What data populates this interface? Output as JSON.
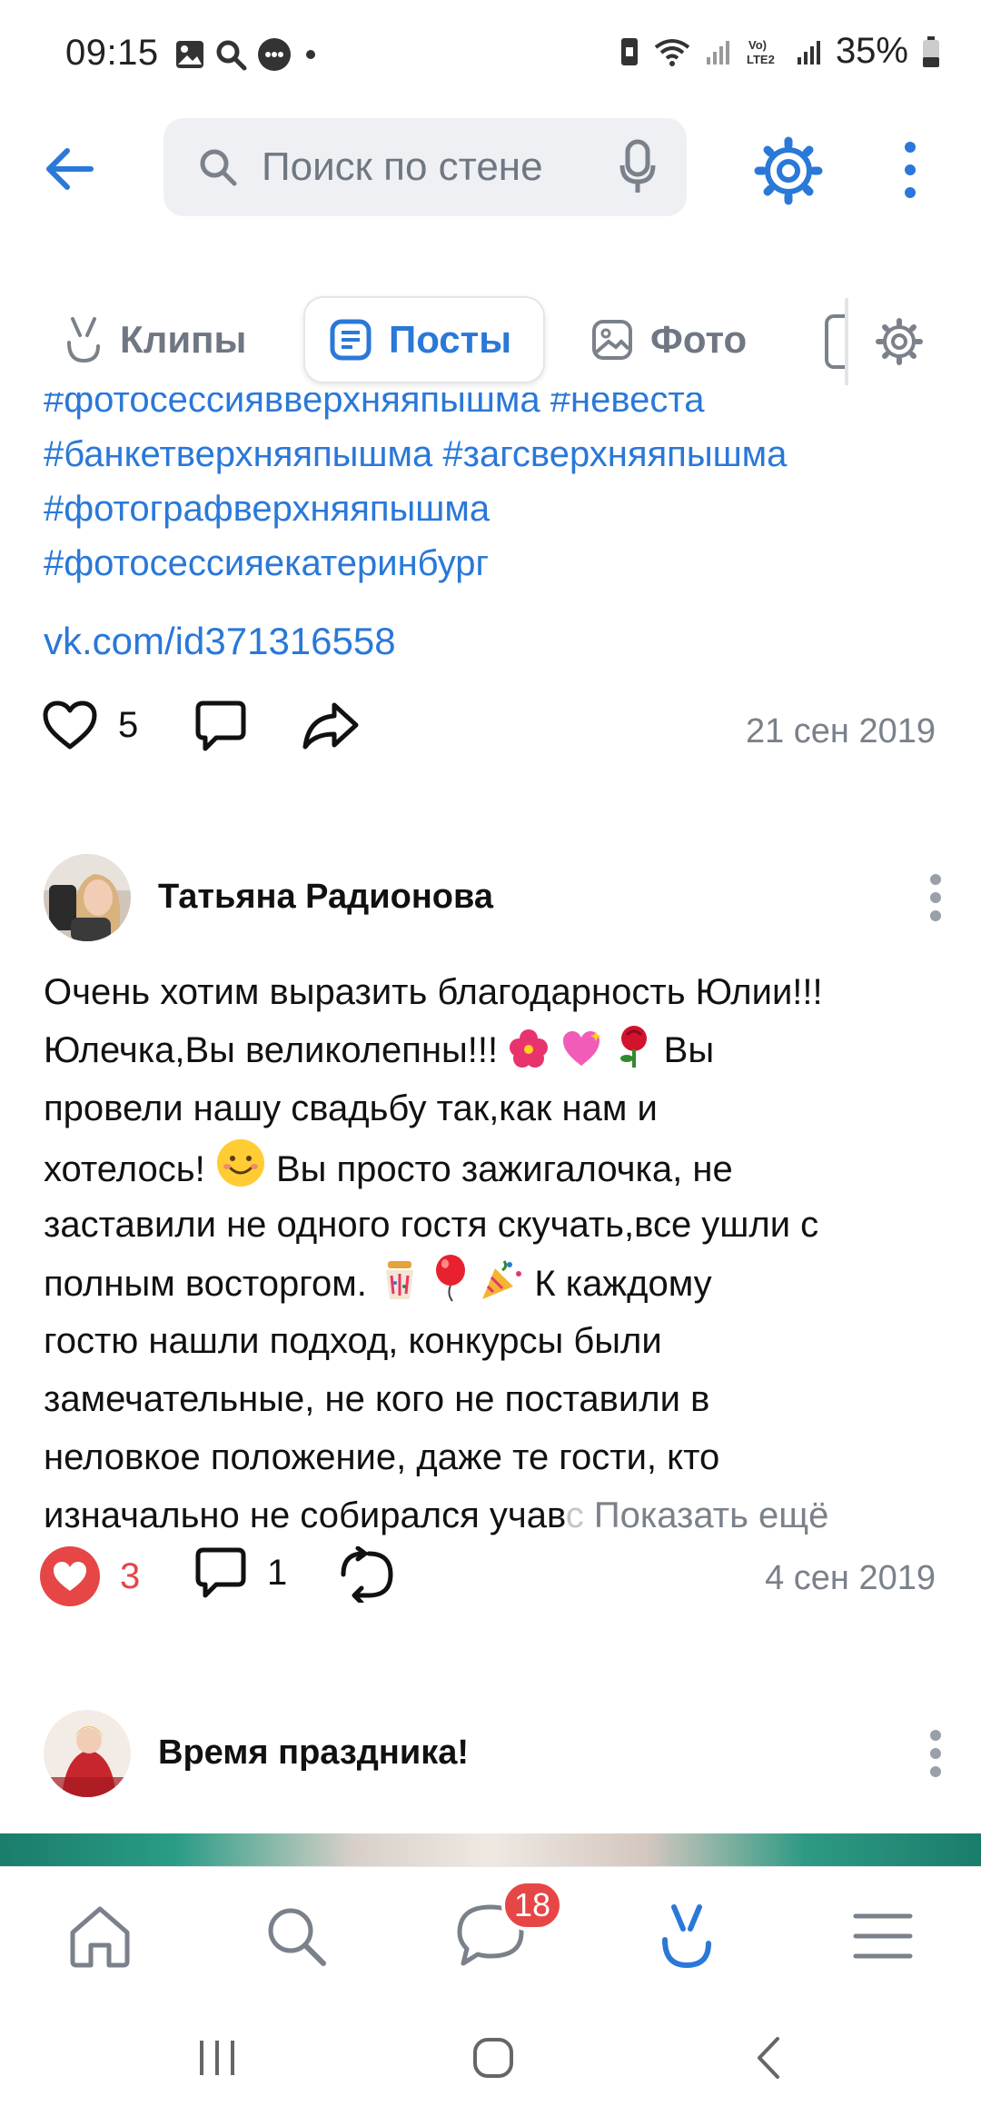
{
  "status_bar": {
    "time": "09:15",
    "battery": "35%",
    "icons": [
      "gallery-icon",
      "search-icon",
      "chat-bubble-icon",
      "dot-icon",
      "sim-icon",
      "wifi-icon",
      "signal-icon",
      "volte-icon",
      "signal-icon",
      "battery-icon"
    ]
  },
  "search": {
    "placeholder": "Поиск по стене"
  },
  "tabs": [
    {
      "label": "Клипы",
      "icon": "clips-icon",
      "active": false
    },
    {
      "label": "Посты",
      "icon": "posts-icon",
      "active": true
    },
    {
      "label": "Фото",
      "icon": "photo-icon",
      "active": false
    }
  ],
  "feed": {
    "hashtags": [
      "#фотосессиявверхняяпышма #невеста",
      "#банкетверхняяпышма #загсверхняяпышма",
      "#фотографверхняяпышма",
      "#фотосессияекатеринбург"
    ],
    "link": "vk.com/id371316558",
    "post1_actions": {
      "likes": "5",
      "date": "21 сен 2019"
    },
    "post2": {
      "author": "Татьяна Радионова",
      "lines": [
        "Очень хотим выразить благодарность Юлии!!!",
        "Юлечка,Вы великолепны!!!",
        "провели нашу свадьбу так,как нам и",
        "хотелось!",
        "заставили не одного гостя скучать,все ушли с",
        "полным восторгом.",
        "гостю нашли подход, конкурсы были",
        "замечательные, не кого не поставили в",
        "неловкое положение, даже те гости, кто",
        "изначально не собирался учав"
      ],
      "line2_tail": "Вы",
      "line4_tail": "Вы просто зажигалочка, не",
      "line6_tail": "К каждому",
      "line10_fade": "с",
      "show_more": "Показать ещё",
      "likes": "3",
      "comments": "1",
      "date": "4 сен 2019"
    },
    "post3": {
      "author": "Время праздника!"
    }
  },
  "bottom_nav": {
    "items": [
      "home-icon",
      "search-icon",
      "messages-icon",
      "clips-icon",
      "menu-icon"
    ],
    "messages_badge": "18"
  },
  "colors": {
    "accent": "#2a78d8",
    "like": "#e64646",
    "secondary_text": "#7a818a"
  }
}
